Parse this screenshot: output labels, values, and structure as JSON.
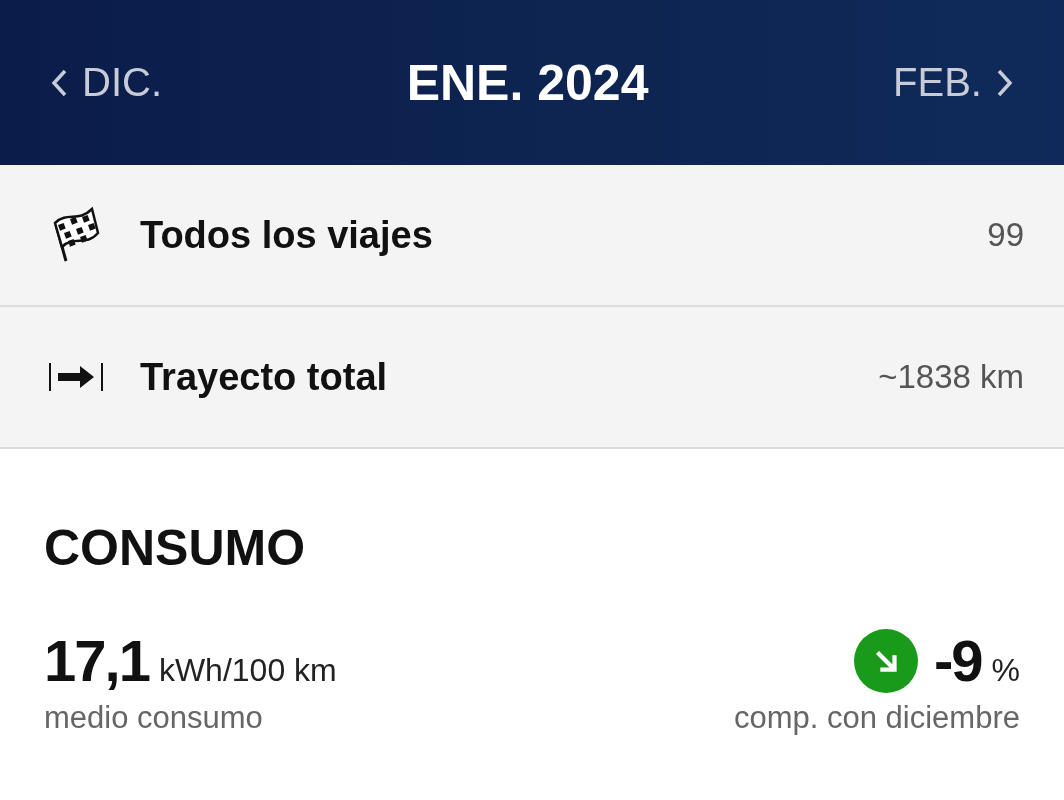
{
  "header": {
    "prev": "DIC.",
    "title": "ENE. 2024",
    "next": "FEB."
  },
  "rows": [
    {
      "kind": "flag",
      "label": "Todos los viajes",
      "value": "99"
    },
    {
      "kind": "distance",
      "label": "Trayecto total",
      "value": "~1838 km"
    }
  ],
  "consumption": {
    "title": "CONSUMO",
    "value": "17,1",
    "unit": "kWh/100 km",
    "caption": "medio consumo",
    "trend": {
      "color": "#1a9a1a",
      "value": "-9",
      "unit": "%",
      "caption": "comp. con diciembre"
    }
  }
}
